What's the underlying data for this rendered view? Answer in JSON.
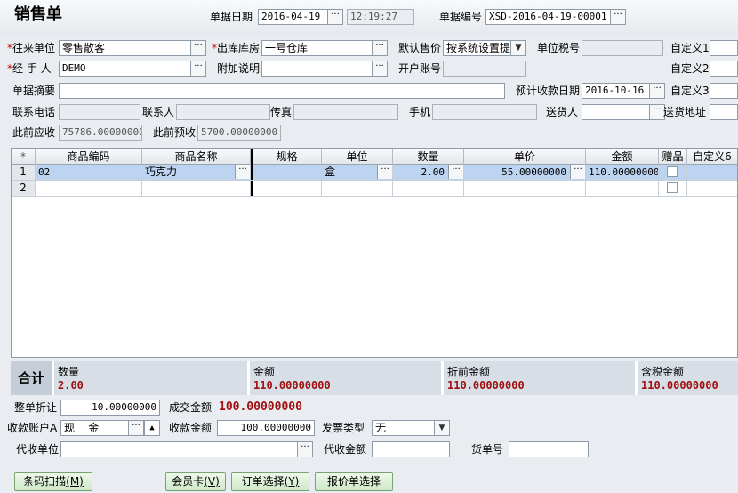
{
  "title": "销售单",
  "header": {
    "date_label": "单据日期",
    "date_value": "2016-04-19",
    "time_value": "12:19:27",
    "docno_label": "单据编号",
    "docno_value": "XSD-2016-04-19-00001"
  },
  "form": {
    "customer_label": "往来单位",
    "customer_value": "零售散客",
    "warehouse_label": "出库库房",
    "warehouse_value": "一号仓库",
    "price_label": "默认售价",
    "price_value": "按系统设置提",
    "taxno_label": "单位税号",
    "custom1_label": "自定义1",
    "handler_label": "经 手 人",
    "handler_value": "DEMO",
    "note_label": "附加说明",
    "account_label": "开户账号",
    "custom2_label": "自定义2",
    "summary_label": "单据摘要",
    "duedate_label": "预计收款日期",
    "duedate_value": "2016-10-16",
    "custom3_label": "自定义3",
    "phone_label": "联系电话",
    "contact_label": "联系人",
    "fax_label": "传真",
    "mobile_label": "手机",
    "deliverer_label": "送货人",
    "address_label": "送货地址",
    "prev_recv_label": "此前应收",
    "prev_recv_value": "75786.00000000",
    "prev_adv_label": "此前预收",
    "prev_adv_value": "5700.00000000"
  },
  "grid": {
    "corner": "*",
    "columns": [
      "商品编码",
      "商品名称",
      "规格",
      "单位",
      "数量",
      "单价",
      "金额",
      "赠品",
      "自定义6"
    ],
    "rows": [
      {
        "num": "1",
        "code": "02",
        "name": "巧克力",
        "spec": "",
        "unit": "盒",
        "qty": "2.00",
        "price": "55.00000000",
        "amount": "110.00000000"
      },
      {
        "num": "2",
        "code": "",
        "name": "",
        "spec": "",
        "unit": "",
        "qty": "",
        "price": "",
        "amount": ""
      }
    ]
  },
  "totals": {
    "label": "合计",
    "qty_label": "数量",
    "qty_value": "2.00",
    "amount_label": "金额",
    "amount_value": "110.00000000",
    "pre_disc_label": "折前金额",
    "pre_disc_value": "110.00000000",
    "tax_amount_label": "含税金额",
    "tax_amount_value": "110.00000000"
  },
  "payment": {
    "discount_label": "整单折让",
    "discount_value": "10.00000000",
    "deal_label": "成交金额",
    "deal_value": "100.00000000",
    "account_label": "收款账户A",
    "account_value": "现    金",
    "recv_label": "收款金额",
    "recv_value": "100.00000000",
    "invoice_label": "发票类型",
    "invoice_value": "无",
    "agent_label": "代收单位",
    "agent_amount_label": "代收金额",
    "cargo_label": "货单号"
  },
  "buttons": {
    "scan": "条码扫描",
    "scan_key": "(M)",
    "member": "会员卡",
    "member_key": "(V)",
    "order": "订单选择",
    "order_key": "(Y)",
    "quote": "报价单选择"
  },
  "colors": {
    "background": "#e9edf1",
    "selected_row": "#bcd4f0",
    "total_value": "#a01010",
    "button": "#cfe8c8"
  }
}
